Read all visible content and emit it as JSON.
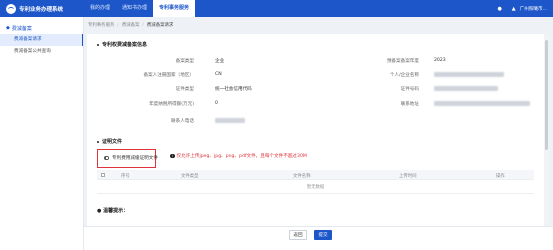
{
  "app": {
    "title": "专利业务办理系统",
    "nav": [
      "我的办理",
      "通知书办理",
      "专利事务服务"
    ],
    "active_nav": 2,
    "user": "广州照曦市..."
  },
  "sidebar": {
    "group": "费减备案",
    "items": [
      "费减备案请求",
      "费减备案公共查询"
    ]
  },
  "breadcrumb": [
    "专利事务服务",
    "费减备案",
    "费减备案请求"
  ],
  "info": {
    "section_title": "专利权费减备案信息",
    "rows": [
      {
        "label": "备案类型",
        "value": "企业",
        "label2": "预备案备案年度",
        "value2": "2023"
      },
      {
        "label": "备案人注册国家（地区）",
        "value": "CN",
        "label2": "个人/企业名称",
        "value2": ""
      },
      {
        "label": "证件类型",
        "value": "统一社会信用代码",
        "label2": "证件号码",
        "value2": ""
      },
      {
        "label": "年度纳税所得额(万元)",
        "value": "0",
        "label2": "联系地址",
        "value2": ""
      },
      {
        "label": "联系人电话",
        "value": "",
        "label2": "",
        "value2": ""
      }
    ]
  },
  "attachments": {
    "section_title": "证明文件",
    "upload_label": "专利费用减缓证明文件",
    "hint": "仅允许上传jpeg、jpg、png、pdf文件，且每个文件不超过30M",
    "columns": [
      "序号",
      "文件类型",
      "文件名称",
      "上传时间",
      "操作"
    ],
    "empty_text": "暂无数据"
  },
  "notice_title": "● 温馨提示：",
  "buttons": {
    "back": "返回",
    "submit": "提交"
  }
}
